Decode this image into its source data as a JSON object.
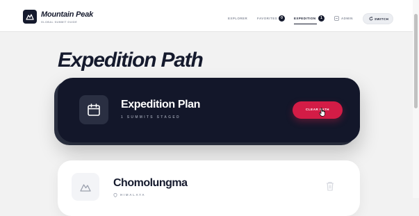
{
  "brand": {
    "name": "Mountain Peak",
    "tagline": "GLOBAL SUMMIT GUIDE"
  },
  "nav": {
    "items": [
      {
        "label": "EXPLORER"
      },
      {
        "label": "FAVORITES",
        "badge": "0"
      },
      {
        "label": "EXPEDITION",
        "badge": "1",
        "active": true
      },
      {
        "label": "ADMIN",
        "icon": "admin-icon"
      }
    ],
    "switch_label": "SWITCH",
    "switch_icon": "refresh-icon"
  },
  "page": {
    "title": "Expedition Path"
  },
  "plan": {
    "title": "Expedition Plan",
    "subtitle": "1 SUMMITS STAGED",
    "icon": "calendar-icon",
    "clear_label": "CLEAR PATH"
  },
  "summits": [
    {
      "name": "Chomolungma",
      "region": "HIMALAYA",
      "icon": "mountain-icon",
      "action_icon": "trash-icon"
    }
  ],
  "colors": {
    "navy": "#151a2d",
    "accent_red": "#d31c46",
    "background": "#f2f2f2"
  }
}
